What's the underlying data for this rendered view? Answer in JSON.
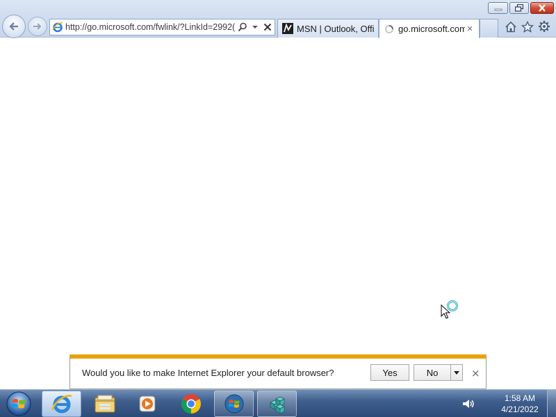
{
  "browser": {
    "address_url": "http://go.microsoft.com/fwlink/?LinkId=2992(",
    "tabs": [
      {
        "label": "MSN | Outlook, Offi...",
        "icon": "msn-icon"
      },
      {
        "label": "go.microsoft.com",
        "icon": "loading-spinner-icon",
        "active": true
      }
    ],
    "window_buttons": [
      "minimize-icon",
      "maximize-icon",
      "close-icon"
    ],
    "toolbar_icons": [
      "home-icon",
      "favorites-star-icon",
      "gear-icon"
    ]
  },
  "notification": {
    "message": "Would you like to make Internet Explorer your default browser?",
    "yes_label": "Yes",
    "no_label": "No",
    "close_glyph": "×",
    "accent_color": "#e8a30c"
  },
  "taskbar": {
    "items": [
      "internet-explorer-icon",
      "file-explorer-icon",
      "media-player-icon",
      "chrome-icon",
      "windows-orb-icon",
      "app-icon"
    ],
    "clock": {
      "time": "1:58 AM",
      "date": "4/21/2022"
    }
  },
  "colors": {
    "taskbar": "#3f5f8e",
    "chrome_bg": "#cfdcee",
    "close_red": "#c0331e"
  }
}
